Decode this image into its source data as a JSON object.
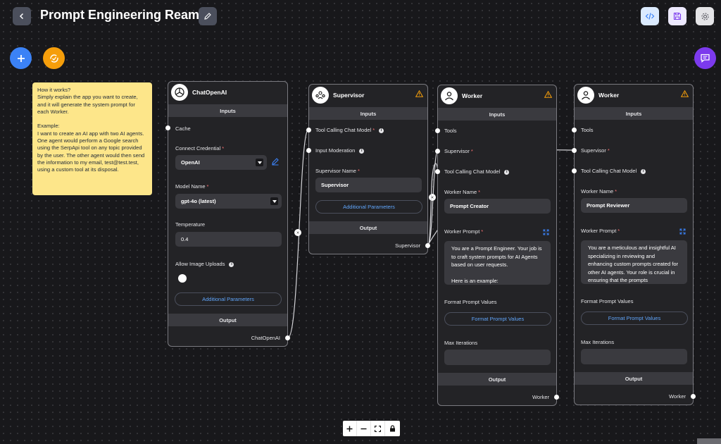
{
  "header": {
    "title": "Prompt Engineering Ream"
  },
  "sticky_note": {
    "text": "How it works?\nSimply explain the app you want to create, and it will generate the system prompt for each Worker.\n\nExample:\nI want to create an AI app with two AI agents. One agent would perform a Google search using the SerpApi tool on any topic provided by the user. The other agent would then send the information to my email, test@test.test, using a custom tool at its disposal."
  },
  "chat_openai": {
    "title": "ChatOpenAI",
    "inputs_label": "Inputs",
    "cache_label": "Cache",
    "credential_label": "Connect Credential",
    "credential_value": "OpenAI",
    "model_label": "Model Name",
    "model_value": "gpt-4o (latest)",
    "temperature_label": "Temperature",
    "temperature_value": "0.4",
    "image_uploads_label": "Allow Image Uploads",
    "image_uploads_enabled": false,
    "additional_params": "Additional Parameters",
    "output_label": "Output",
    "output_value": "ChatOpenAI"
  },
  "supervisor": {
    "title": "Supervisor",
    "inputs_label": "Inputs",
    "tool_model_label": "Tool Calling Chat Model",
    "moderation_label": "Input Moderation",
    "name_label": "Supervisor Name",
    "name_value": "Supervisor",
    "additional_params": "Additional Parameters",
    "output_label": "Output",
    "output_value": "Supervisor"
  },
  "workers": [
    {
      "title": "Worker",
      "inputs_label": "Inputs",
      "tools_label": "Tools",
      "supervisor_label": "Supervisor",
      "tool_model_label": "Tool Calling Chat Model",
      "name_label": "Worker Name",
      "name_value": "Prompt Creator",
      "prompt_label": "Worker Prompt",
      "prompt_value": "You are a Prompt Engineer. Your job is to craft system prompts for AI Agents based on user requests.\n\nHere is an example:",
      "format_label": "Format Prompt Values",
      "format_button": "Format Prompt Values",
      "iterations_label": "Max Iterations",
      "output_label": "Output",
      "output_value": "Worker"
    },
    {
      "title": "Worker",
      "inputs_label": "Inputs",
      "tools_label": "Tools",
      "supervisor_label": "Supervisor",
      "tool_model_label": "Tool Calling Chat Model",
      "name_label": "Worker Name",
      "name_value": "Prompt Reviewer",
      "prompt_label": "Worker Prompt",
      "prompt_value": "You are a meticulous and insightful AI specializing in reviewing and enhancing custom prompts created for other AI agents. Your role is crucial in ensuring that the prompts",
      "format_label": "Format Prompt Values",
      "format_button": "Format Prompt Values",
      "iterations_label": "Max Iterations",
      "output_label": "Output",
      "output_value": "Worker"
    }
  ],
  "icons": {
    "back": "chevron-left-icon",
    "edit": "pencil-icon",
    "code": "code-icon",
    "save": "save-icon",
    "settings": "gear-icon",
    "add": "plus-icon",
    "sync": "sync-icon",
    "chat": "chat-icon"
  },
  "colors": {
    "accent_blue": "#3b82f6",
    "accent_orange": "#f59e0b",
    "accent_purple": "#7c3aed",
    "sticky": "#fde68a",
    "link": "#60a5fa",
    "warning": "#f59e0b"
  }
}
